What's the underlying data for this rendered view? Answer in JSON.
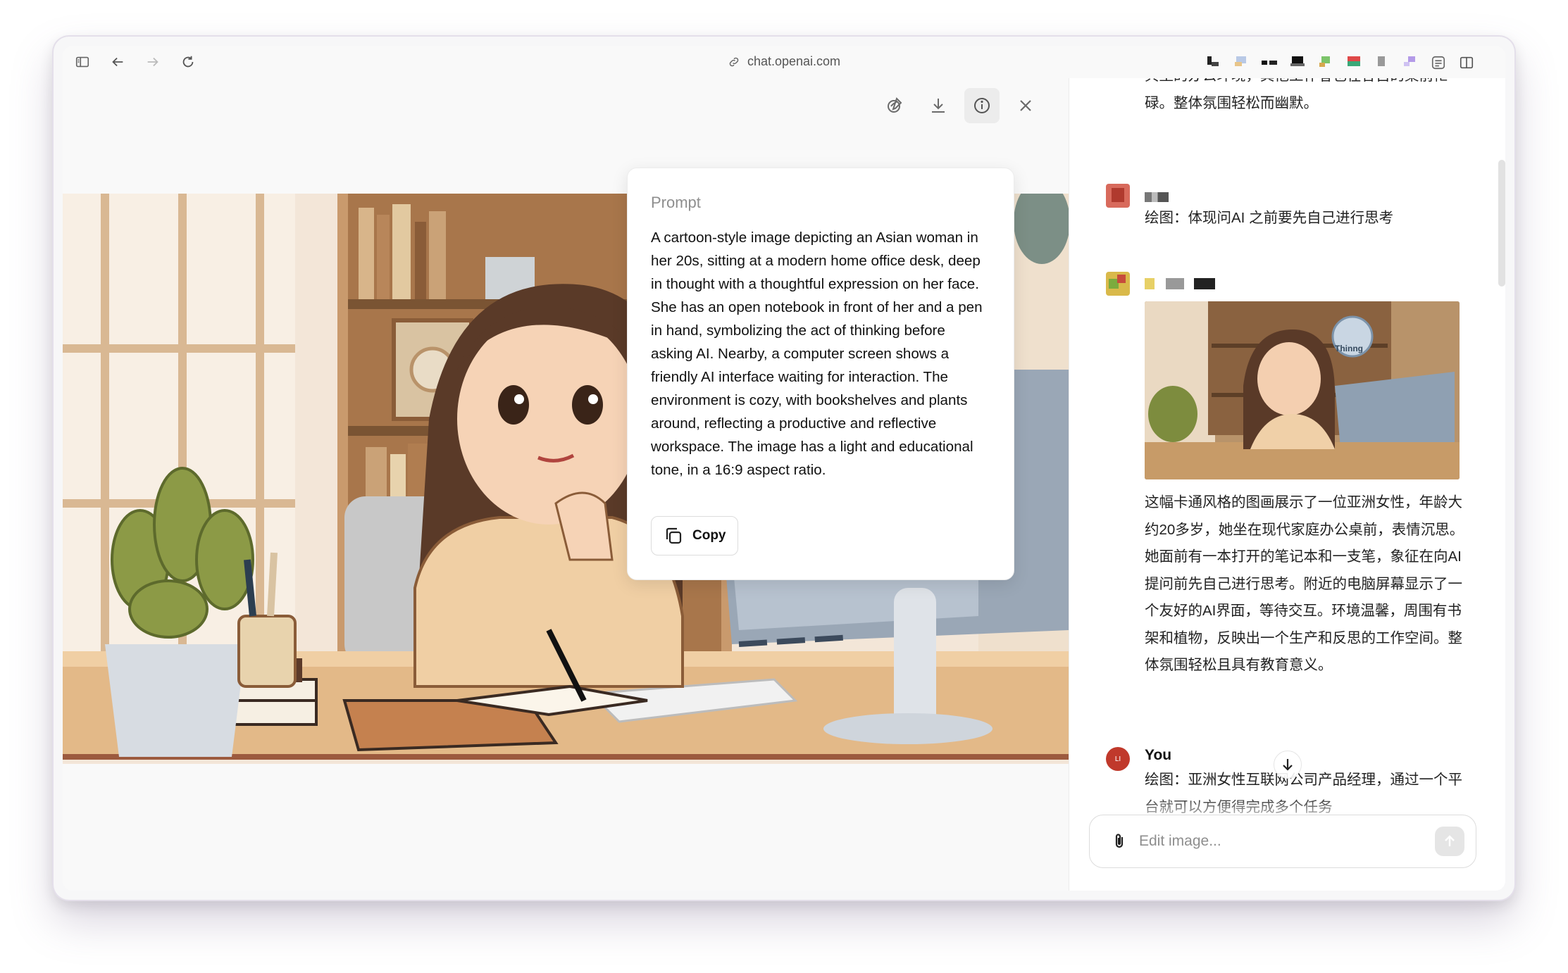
{
  "browser": {
    "url": "chat.openai.com"
  },
  "viewer": {
    "prompt_title": "Prompt",
    "prompt_text": "A cartoon-style image depicting an Asian woman in her 20s, sitting at a modern home office desk, deep in thought with a thoughtful expression on her face. She has an open notebook in front of her and a pen in hand, symbolizing the act of thinking before asking AI. Nearby, a computer screen shows a friendly AI interface waiting for interaction. The environment is cozy, with bookshelves and plants around, reflecting a productive and reflective workspace. The image has a light and educational tone, in a 16:9 aspect ratio.",
    "copy_label": "Copy",
    "tools": [
      "edit-icon",
      "download-icon",
      "info-icon",
      "close-icon"
    ]
  },
  "chat": {
    "prev_text": "典型的办公环境，其他工作者也在各自的桌前忙碌。整体氛围轻松而幽默。",
    "user_msg_1": "绘图：体现问AI 之前要先自己进行思考",
    "thumb_badge": "Thinng",
    "assistant_text": "这幅卡通风格的图画展示了一位亚洲女性，年龄大约20多岁，她坐在现代家庭办公桌前，表情沉思。她面前有一本打开的笔记本和一支笔，象征在向AI提问前先自己进行思考。附近的电脑屏幕显示了一个友好的AI界面，等待交互。环境温馨，周围有书架和植物，反映出一个生产和反思的工作空间。整体氛围轻松且具有教育意义。",
    "you_label": "You",
    "user_avatar_initials": "LI",
    "user_msg_2": "绘图：亚洲女性互联网公司产品经理，通过一个平台就可以方便得完成多个任务",
    "composer_placeholder": "Edit image..."
  },
  "colors": {
    "accent_user_avatar": "#c0392b",
    "send_button_bg": "#e5e5e5"
  }
}
